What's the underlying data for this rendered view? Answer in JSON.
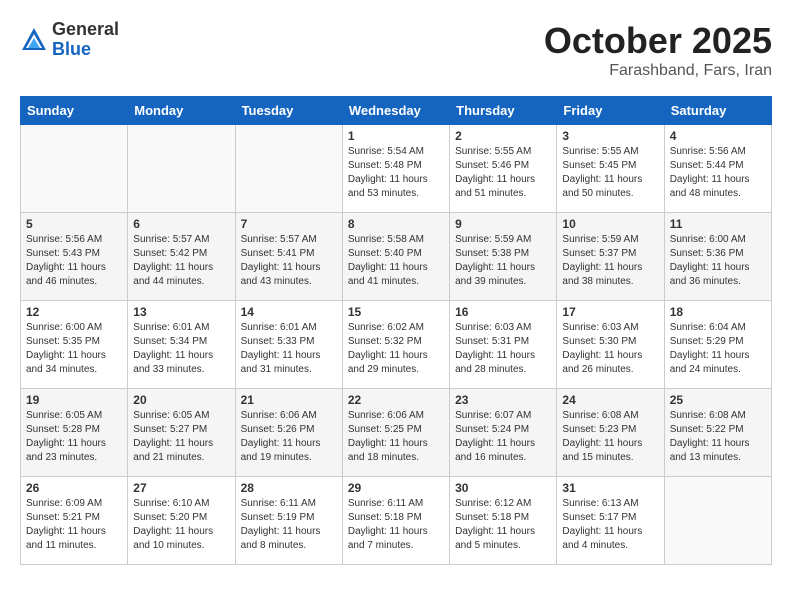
{
  "header": {
    "logo_general": "General",
    "logo_blue": "Blue",
    "title": "October 2025",
    "subtitle": "Farashband, Fars, Iran"
  },
  "weekdays": [
    "Sunday",
    "Monday",
    "Tuesday",
    "Wednesday",
    "Thursday",
    "Friday",
    "Saturday"
  ],
  "weeks": [
    [
      {
        "day": "",
        "info": ""
      },
      {
        "day": "",
        "info": ""
      },
      {
        "day": "",
        "info": ""
      },
      {
        "day": "1",
        "info": "Sunrise: 5:54 AM\nSunset: 5:48 PM\nDaylight: 11 hours\nand 53 minutes."
      },
      {
        "day": "2",
        "info": "Sunrise: 5:55 AM\nSunset: 5:46 PM\nDaylight: 11 hours\nand 51 minutes."
      },
      {
        "day": "3",
        "info": "Sunrise: 5:55 AM\nSunset: 5:45 PM\nDaylight: 11 hours\nand 50 minutes."
      },
      {
        "day": "4",
        "info": "Sunrise: 5:56 AM\nSunset: 5:44 PM\nDaylight: 11 hours\nand 48 minutes."
      }
    ],
    [
      {
        "day": "5",
        "info": "Sunrise: 5:56 AM\nSunset: 5:43 PM\nDaylight: 11 hours\nand 46 minutes."
      },
      {
        "day": "6",
        "info": "Sunrise: 5:57 AM\nSunset: 5:42 PM\nDaylight: 11 hours\nand 44 minutes."
      },
      {
        "day": "7",
        "info": "Sunrise: 5:57 AM\nSunset: 5:41 PM\nDaylight: 11 hours\nand 43 minutes."
      },
      {
        "day": "8",
        "info": "Sunrise: 5:58 AM\nSunset: 5:40 PM\nDaylight: 11 hours\nand 41 minutes."
      },
      {
        "day": "9",
        "info": "Sunrise: 5:59 AM\nSunset: 5:38 PM\nDaylight: 11 hours\nand 39 minutes."
      },
      {
        "day": "10",
        "info": "Sunrise: 5:59 AM\nSunset: 5:37 PM\nDaylight: 11 hours\nand 38 minutes."
      },
      {
        "day": "11",
        "info": "Sunrise: 6:00 AM\nSunset: 5:36 PM\nDaylight: 11 hours\nand 36 minutes."
      }
    ],
    [
      {
        "day": "12",
        "info": "Sunrise: 6:00 AM\nSunset: 5:35 PM\nDaylight: 11 hours\nand 34 minutes."
      },
      {
        "day": "13",
        "info": "Sunrise: 6:01 AM\nSunset: 5:34 PM\nDaylight: 11 hours\nand 33 minutes."
      },
      {
        "day": "14",
        "info": "Sunrise: 6:01 AM\nSunset: 5:33 PM\nDaylight: 11 hours\nand 31 minutes."
      },
      {
        "day": "15",
        "info": "Sunrise: 6:02 AM\nSunset: 5:32 PM\nDaylight: 11 hours\nand 29 minutes."
      },
      {
        "day": "16",
        "info": "Sunrise: 6:03 AM\nSunset: 5:31 PM\nDaylight: 11 hours\nand 28 minutes."
      },
      {
        "day": "17",
        "info": "Sunrise: 6:03 AM\nSunset: 5:30 PM\nDaylight: 11 hours\nand 26 minutes."
      },
      {
        "day": "18",
        "info": "Sunrise: 6:04 AM\nSunset: 5:29 PM\nDaylight: 11 hours\nand 24 minutes."
      }
    ],
    [
      {
        "day": "19",
        "info": "Sunrise: 6:05 AM\nSunset: 5:28 PM\nDaylight: 11 hours\nand 23 minutes."
      },
      {
        "day": "20",
        "info": "Sunrise: 6:05 AM\nSunset: 5:27 PM\nDaylight: 11 hours\nand 21 minutes."
      },
      {
        "day": "21",
        "info": "Sunrise: 6:06 AM\nSunset: 5:26 PM\nDaylight: 11 hours\nand 19 minutes."
      },
      {
        "day": "22",
        "info": "Sunrise: 6:06 AM\nSunset: 5:25 PM\nDaylight: 11 hours\nand 18 minutes."
      },
      {
        "day": "23",
        "info": "Sunrise: 6:07 AM\nSunset: 5:24 PM\nDaylight: 11 hours\nand 16 minutes."
      },
      {
        "day": "24",
        "info": "Sunrise: 6:08 AM\nSunset: 5:23 PM\nDaylight: 11 hours\nand 15 minutes."
      },
      {
        "day": "25",
        "info": "Sunrise: 6:08 AM\nSunset: 5:22 PM\nDaylight: 11 hours\nand 13 minutes."
      }
    ],
    [
      {
        "day": "26",
        "info": "Sunrise: 6:09 AM\nSunset: 5:21 PM\nDaylight: 11 hours\nand 11 minutes."
      },
      {
        "day": "27",
        "info": "Sunrise: 6:10 AM\nSunset: 5:20 PM\nDaylight: 11 hours\nand 10 minutes."
      },
      {
        "day": "28",
        "info": "Sunrise: 6:11 AM\nSunset: 5:19 PM\nDaylight: 11 hours\nand 8 minutes."
      },
      {
        "day": "29",
        "info": "Sunrise: 6:11 AM\nSunset: 5:18 PM\nDaylight: 11 hours\nand 7 minutes."
      },
      {
        "day": "30",
        "info": "Sunrise: 6:12 AM\nSunset: 5:18 PM\nDaylight: 11 hours\nand 5 minutes."
      },
      {
        "day": "31",
        "info": "Sunrise: 6:13 AM\nSunset: 5:17 PM\nDaylight: 11 hours\nand 4 minutes."
      },
      {
        "day": "",
        "info": ""
      }
    ]
  ]
}
